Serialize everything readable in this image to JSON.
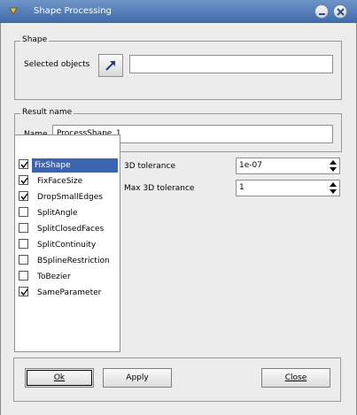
{
  "window": {
    "title": "Shape Processing"
  },
  "shape_group": {
    "legend": "Shape",
    "selected_label": "Selected objects",
    "selected_value": ""
  },
  "result_group": {
    "legend": "Result name",
    "name_label": "Name",
    "name_value": "ProcessShape_1"
  },
  "operators": [
    {
      "label": "FixShape",
      "checked": true,
      "selected": true
    },
    {
      "label": "FixFaceSize",
      "checked": true,
      "selected": false
    },
    {
      "label": "DropSmallEdges",
      "checked": true,
      "selected": false
    },
    {
      "label": "SplitAngle",
      "checked": false,
      "selected": false
    },
    {
      "label": "SplitClosedFaces",
      "checked": false,
      "selected": false
    },
    {
      "label": "SplitContinuity",
      "checked": false,
      "selected": false
    },
    {
      "label": "BSplineRestriction",
      "checked": false,
      "selected": false
    },
    {
      "label": "ToBezier",
      "checked": false,
      "selected": false
    },
    {
      "label": "SameParameter",
      "checked": true,
      "selected": false
    }
  ],
  "params": {
    "tol3d_label": "3D tolerance",
    "tol3d_value": "1e-07",
    "maxtol3d_label": "Max 3D tolerance",
    "maxtol3d_value": "1"
  },
  "buttons": {
    "ok": "Ok",
    "apply": "Apply",
    "close": "Close"
  },
  "colors": {
    "titlebar": "#4f7ab8",
    "selection": "#3c64b0"
  }
}
